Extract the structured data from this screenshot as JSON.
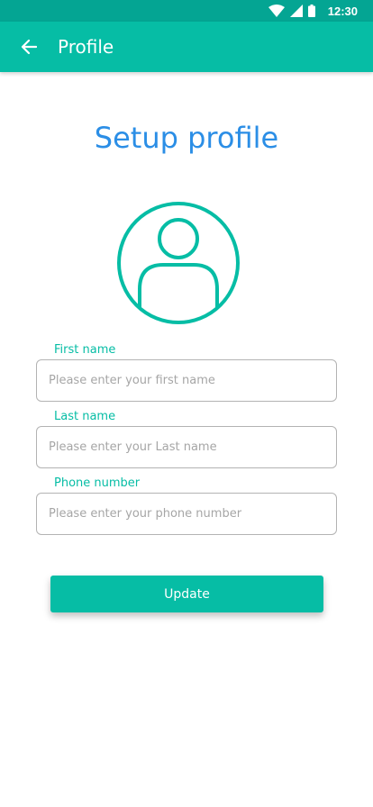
{
  "status_bar": {
    "time": "12:30",
    "icons": [
      "wifi-icon",
      "cellular-signal-icon",
      "battery-icon"
    ]
  },
  "app_bar": {
    "back_icon": "arrow-left-icon",
    "title": "Profile"
  },
  "heading": "Setup profile",
  "avatar_icon": "user-avatar-icon",
  "form": {
    "first_name": {
      "label": "First name",
      "placeholder": "Please enter your first name",
      "value": ""
    },
    "last_name": {
      "label": "Last name",
      "placeholder": "Please enter your Last name",
      "value": ""
    },
    "phone": {
      "label": "Phone number",
      "placeholder": "Please enter your phone number",
      "value": ""
    }
  },
  "update_button": "Update",
  "colors": {
    "status_bar": "#04a593",
    "primary": "#06bda5",
    "heading": "#2b8ee6",
    "input_border": "#b3b3b3",
    "placeholder": "#a6a6a6"
  }
}
